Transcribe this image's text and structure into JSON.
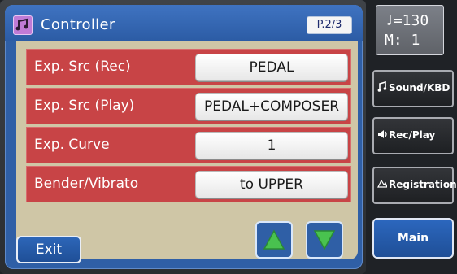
{
  "header": {
    "title": "Controller",
    "page_indicator": "P.2/3"
  },
  "settings": [
    {
      "label": "Exp. Src (Rec)",
      "value": "PEDAL"
    },
    {
      "label": "Exp. Src (Play)",
      "value": "PEDAL+COMPOSER"
    },
    {
      "label": "Exp. Curve",
      "value": "1"
    },
    {
      "label": "Bender/Vibrato",
      "value": "to UPPER"
    }
  ],
  "footer": {
    "exit_label": "Exit"
  },
  "sidebar": {
    "tempo": "♩=130",
    "measure": "M:  1",
    "buttons": [
      {
        "label": "Sound/KBD",
        "icon": "music-note-icon"
      },
      {
        "label": "Rec/Play",
        "icon": "speaker-icon"
      },
      {
        "label": "Registration",
        "icon": "registration-icon"
      }
    ],
    "main_label": "Main"
  },
  "colors": {
    "title_bar": "#2f5fa6",
    "content_bg": "#cfc6a6",
    "row_red": "#c84446",
    "value_bg": "#ffffff",
    "arrow_green": "#49c24f"
  },
  "icons": {
    "title": "music-score-icon",
    "up": "arrow-up-icon",
    "down": "arrow-down-icon"
  }
}
